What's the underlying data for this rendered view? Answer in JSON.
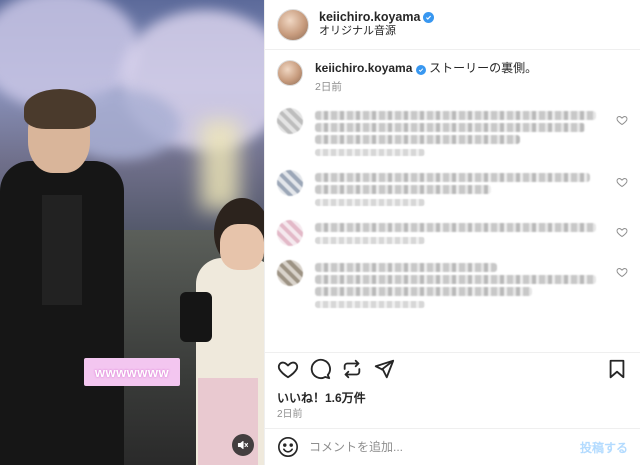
{
  "media": {
    "caption_overlay": "wwwwwww",
    "mute_icon": "speaker-muted-icon"
  },
  "header": {
    "username": "keiichiro.koyama",
    "audio_label": "オリジナル音源",
    "verified_icon": "verified-badge-icon"
  },
  "caption": {
    "username": "keiichiro.koyama",
    "text": "ストーリーの裏側。",
    "time": "2日前"
  },
  "actions": {
    "like_icon": "heart-icon",
    "comment_icon": "comment-icon",
    "share_icon": "repost-icon",
    "send_icon": "send-icon",
    "save_icon": "bookmark-icon"
  },
  "likes": "いいね！1.6万件",
  "post_date": "2日前",
  "composer": {
    "placeholder": "コメントを追加...",
    "post_label": "投稿する",
    "emoji_icon": "emoji-icon"
  },
  "colors": {
    "verified": "#3897f0",
    "post_button": "#b3dbff",
    "caption_overlay_bg": "#f3c6f0"
  }
}
